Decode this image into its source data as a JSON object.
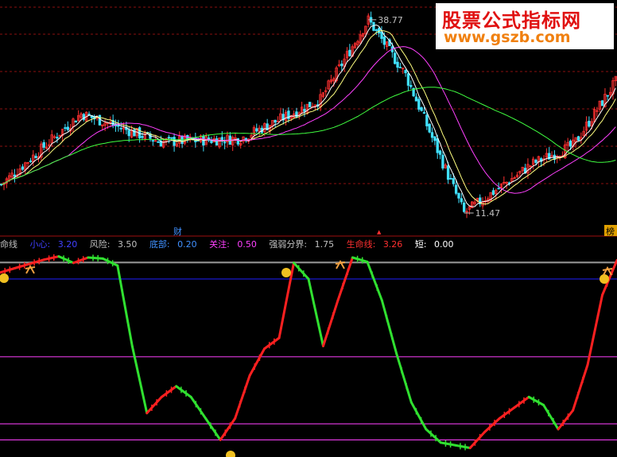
{
  "watermark": {
    "line1": "股票公式指标网",
    "line2": "www.gszb.com"
  },
  "upper_chart": {
    "price_high_label": "38.77",
    "price_low_label": "11.47",
    "marker_cai": "财",
    "marker_small": "▲",
    "marker_bang": "榜",
    "colors": {
      "up": "#ff3030",
      "down": "#40e0ff",
      "ma5": "#ffffff",
      "ma10": "#ffff80",
      "ma20": "#ff40ff",
      "ma60": "#40ff40"
    }
  },
  "indicator_bar": {
    "items": [
      {
        "label": "命线",
        "value": "",
        "color": "#c0c0c0"
      },
      {
        "label": "小心:",
        "value": "3.20",
        "color": "#4040ff"
      },
      {
        "label": "风险:",
        "value": "3.50",
        "color": "#c0c0c0"
      },
      {
        "label": "底部:",
        "value": "0.20",
        "color": "#4090ff"
      },
      {
        "label": "关注:",
        "value": "0.50",
        "color": "#ff40ff"
      },
      {
        "label": "强弱分界:",
        "value": "1.75",
        "color": "#c0c0c0"
      },
      {
        "label": "生命线:",
        "value": "3.26",
        "color": "#ff3030"
      },
      {
        "label": "短:",
        "value": "0.00",
        "color": "#ffffff"
      }
    ]
  },
  "chart_data": [
    {
      "type": "candlestick",
      "title": "",
      "annotations": [
        "38.77",
        "11.47"
      ],
      "y_range_estimated": [
        9,
        41
      ],
      "key_points": [
        {
          "bar": 0,
          "price": 15.5
        },
        {
          "bar": 30,
          "price": 25.5
        },
        {
          "bar": 60,
          "price": 21.5
        },
        {
          "bar": 90,
          "price": 22.0
        },
        {
          "bar": 120,
          "price": 27.5
        },
        {
          "bar": 138,
          "price": 38.77
        },
        {
          "bar": 152,
          "price": 31.0
        },
        {
          "bar": 174,
          "price": 11.47
        },
        {
          "bar": 200,
          "price": 18.5
        },
        {
          "bar": 215,
          "price": 21.0
        },
        {
          "bar": 231,
          "price": 30.0
        }
      ],
      "moving_averages": [
        "ma5",
        "ma10",
        "ma20",
        "ma60"
      ]
    },
    {
      "type": "line",
      "title": "",
      "series": [
        {
          "name": "",
          "values": [
            3.32,
            3.4,
            3.48,
            3.56,
            3.62,
            3.5,
            3.6,
            3.58,
            3.45,
            1.95,
            0.7,
            1.0,
            1.2,
            1.0,
            0.6,
            0.2,
            0.6,
            1.4,
            1.9,
            2.1,
            3.5,
            3.2,
            1.95,
            2.8,
            3.6,
            3.52,
            2.8,
            1.8,
            0.9,
            0.4,
            0.15,
            0.1,
            0.05,
            0.35,
            0.6,
            0.8,
            1.0,
            0.85,
            0.4,
            0.75,
            1.6,
            2.9,
            3.55
          ]
        }
      ],
      "reference_lines": [
        {
          "label": "风险",
          "value": 3.5
        },
        {
          "label": "小心",
          "value": 3.2
        },
        {
          "label": "强弱分界",
          "value": 1.75
        },
        {
          "label": "底部",
          "value": 0.2
        },
        {
          "label": "关注",
          "value": 0.5
        }
      ],
      "ylim": [
        0,
        4
      ]
    }
  ]
}
